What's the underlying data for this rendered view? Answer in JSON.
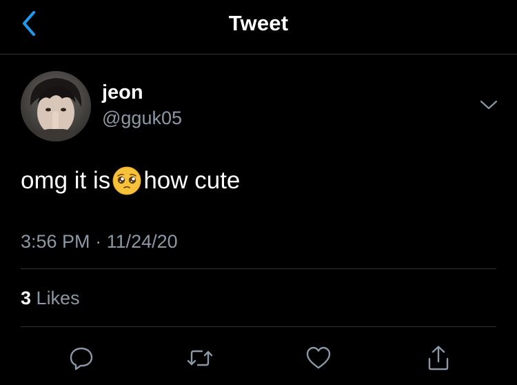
{
  "nav": {
    "title": "Tweet",
    "back_icon": "chevron-left-icon",
    "accent": "#1d9bf0"
  },
  "tweet": {
    "author_name": "jeon",
    "author_handle": "@gguk05",
    "text_before": "omg it is",
    "emoji": "pleading-face-emoji",
    "text_after": "how cute",
    "time": "3:56 PM",
    "separator": "·",
    "date": "11/24/20",
    "likes_count": "3",
    "likes_label": "Likes"
  },
  "actions": [
    {
      "name": "reply",
      "icon": "reply-icon"
    },
    {
      "name": "retweet",
      "icon": "retweet-icon"
    },
    {
      "name": "like",
      "icon": "heart-icon"
    },
    {
      "name": "share",
      "icon": "share-icon"
    }
  ],
  "colors": {
    "background": "#000000",
    "text": "#ffffff",
    "secondary_text": "#8b98a5",
    "divider": "#2f3336"
  }
}
